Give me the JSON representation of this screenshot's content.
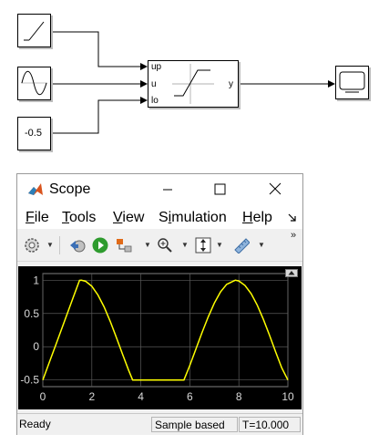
{
  "diagram": {
    "constant_value": "-0.5",
    "saturation_ports": {
      "up": "up",
      "u": "u",
      "lo": "lo",
      "y": "y"
    }
  },
  "scope": {
    "title": "Scope",
    "menus": [
      {
        "key": "F",
        "rest": "ile"
      },
      {
        "key": "T",
        "rest": "ools"
      },
      {
        "key": "V",
        "rest": "iew"
      },
      {
        "pre": "S",
        "key": "i",
        "rest": "mulation"
      },
      {
        "key": "H",
        "rest": "elp"
      }
    ],
    "status": {
      "ready": "Ready",
      "mode": "Sample based",
      "time": "T=10.000"
    }
  },
  "chart_data": {
    "type": "line",
    "line_color": "#ffff00",
    "background": "#000000",
    "grid": true,
    "xlim": [
      0,
      10
    ],
    "ylim": [
      -0.6,
      1.1
    ],
    "xticks": [
      0,
      2,
      4,
      6,
      8,
      10
    ],
    "yticks": [
      -0.5,
      0,
      0.5,
      1
    ],
    "ytick_labels": [
      "-0.5",
      "0",
      "0.5",
      "1"
    ],
    "series": [
      {
        "x": [
          0.0,
          0.25,
          0.5,
          0.75,
          1.0,
          1.25,
          1.5,
          1.571,
          1.75,
          2.0,
          2.25,
          2.5,
          2.75,
          3.0,
          3.25,
          3.5,
          3.665,
          4.0,
          4.5,
          5.0,
          5.5,
          5.76,
          6.0,
          6.25,
          6.5,
          6.75,
          7.0,
          7.25,
          7.5,
          7.854,
          8.0,
          8.25,
          8.5,
          8.75,
          9.0,
          9.25,
          9.5,
          9.75,
          10.0
        ],
        "y": [
          -0.5,
          -0.25,
          0.0,
          0.25,
          0.5,
          0.75,
          0.997,
          1.0,
          0.984,
          0.909,
          0.778,
          0.598,
          0.382,
          0.141,
          -0.108,
          -0.351,
          -0.5,
          -0.5,
          -0.5,
          -0.5,
          -0.5,
          -0.5,
          -0.279,
          -0.033,
          0.215,
          0.45,
          0.657,
          0.823,
          0.938,
          1.0,
          0.989,
          0.922,
          0.798,
          0.624,
          0.412,
          0.174,
          -0.075,
          -0.319,
          -0.5
        ]
      }
    ]
  }
}
